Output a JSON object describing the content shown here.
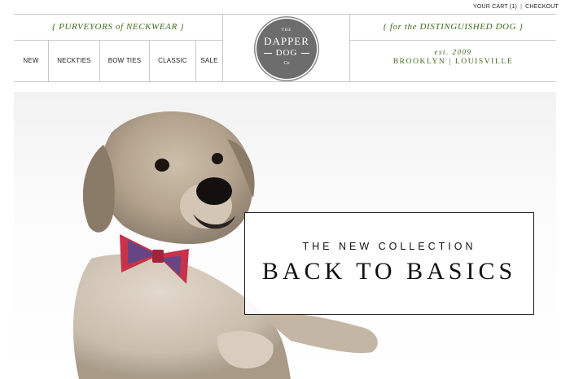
{
  "utility": {
    "cart_label": "YOUR CART (1)",
    "separator": "|",
    "checkout_label": "CHECKOUT"
  },
  "header": {
    "tagline_left": "{ PURVEYORS of NECKWEAR }",
    "tagline_right": "{ for the DISTINGUISHED DOG }",
    "logo": {
      "the": "THE",
      "dapper": "DAPPER",
      "dog": "DOG",
      "co": "Co"
    },
    "est": "est. 2009",
    "cities": "BROOKLYN | LOUISVILLE"
  },
  "nav": {
    "items": [
      {
        "label": "NEW"
      },
      {
        "label": "NECKTIES"
      },
      {
        "label": "BOW TIES"
      },
      {
        "label": "CLASSIC"
      },
      {
        "label": "SALE"
      }
    ]
  },
  "hero": {
    "kicker": "THE NEW COLLECTION",
    "headline": "BACK TO BASICS"
  },
  "colors": {
    "accent_green": "#3f6a1e",
    "logo_gray": "#6d6d6d",
    "rule_gray": "#c9c9c9"
  }
}
